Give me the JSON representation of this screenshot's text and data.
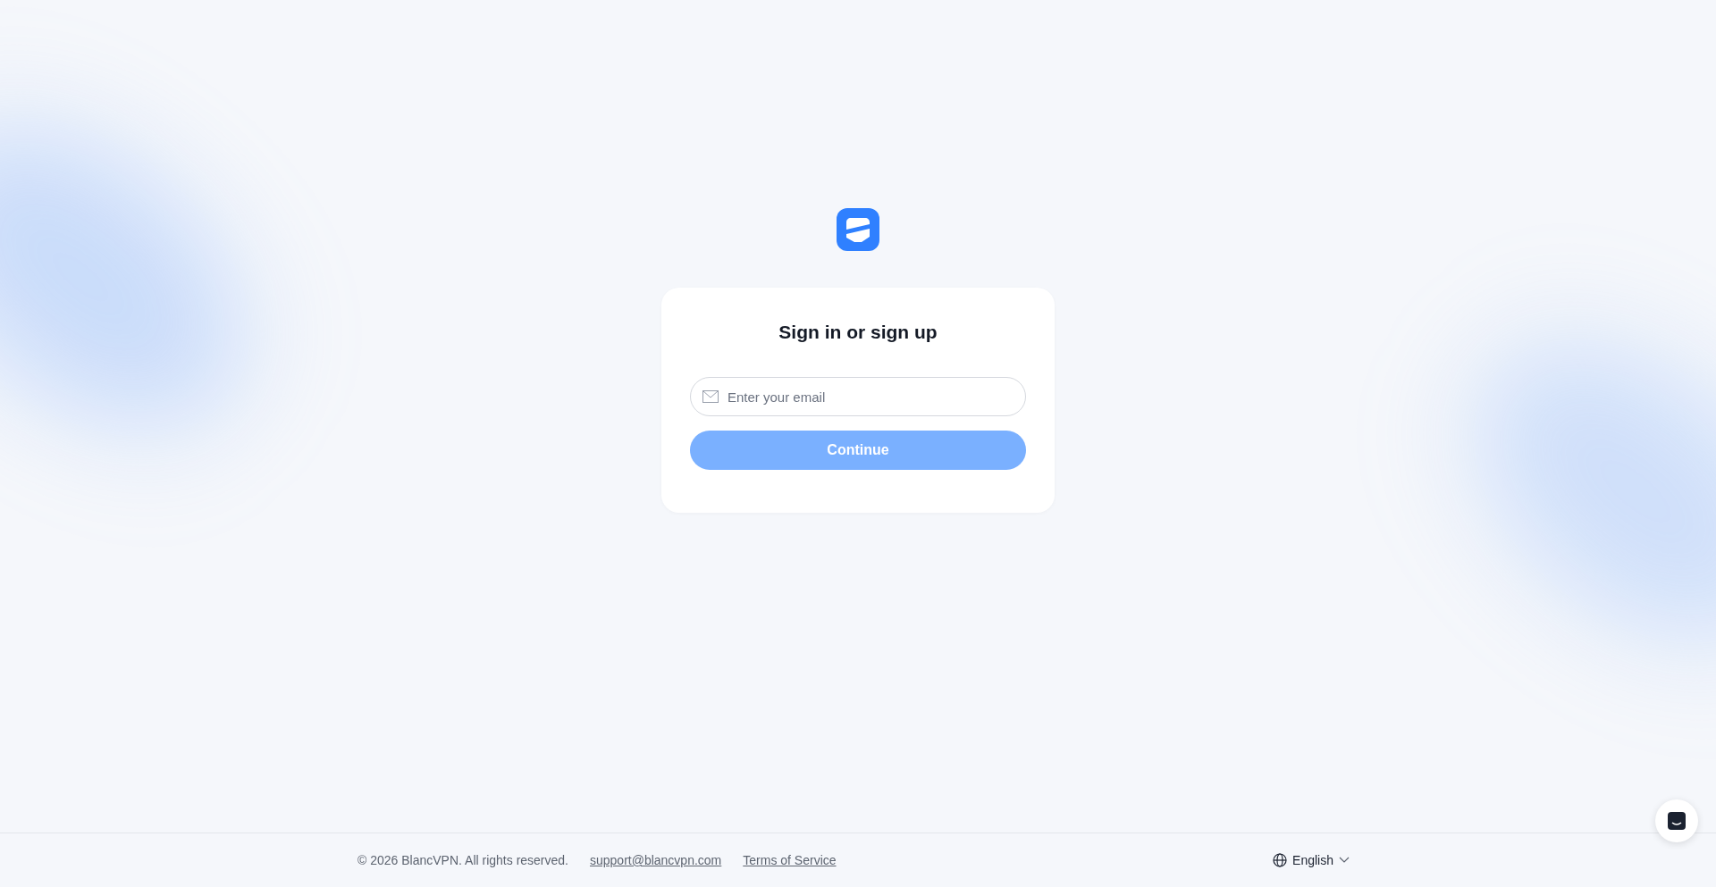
{
  "card": {
    "title": "Sign in or sign up",
    "email_field": {
      "placeholder": "Enter your email"
    },
    "continue_button": {
      "label": "Continue",
      "disabled": true
    }
  },
  "footer": {
    "copyright": "© 2026 BlancVPN. All rights reserved.",
    "links": [
      "support@blancvpn.com",
      "Terms of Service"
    ],
    "language": "English"
  }
}
